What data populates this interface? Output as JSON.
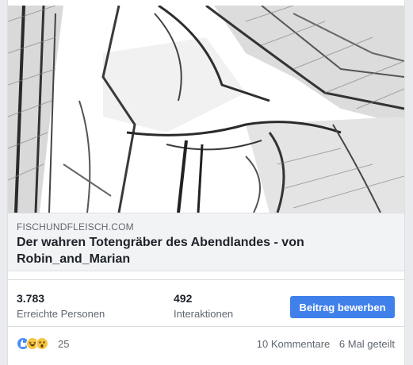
{
  "link_preview": {
    "domain": "FISCHUNDFLEISCH.COM",
    "headline": "Der wahren Totengräber des Abendlandes - von Robin_and_Marian"
  },
  "stats": {
    "reach_value": "3.783",
    "reach_label": "Erreichte Personen",
    "engagement_value": "492",
    "engagement_label": "Interaktionen",
    "promote_label": "Beitrag bewerben"
  },
  "reactions": {
    "icons": [
      "like-icon",
      "haha-icon",
      "wow-icon"
    ],
    "count": "25",
    "comments": "10 Kommentare",
    "shares": "6 Mal geteilt"
  },
  "colors": {
    "accent": "#4080ea",
    "link_box_bg": "#f2f3f5"
  }
}
